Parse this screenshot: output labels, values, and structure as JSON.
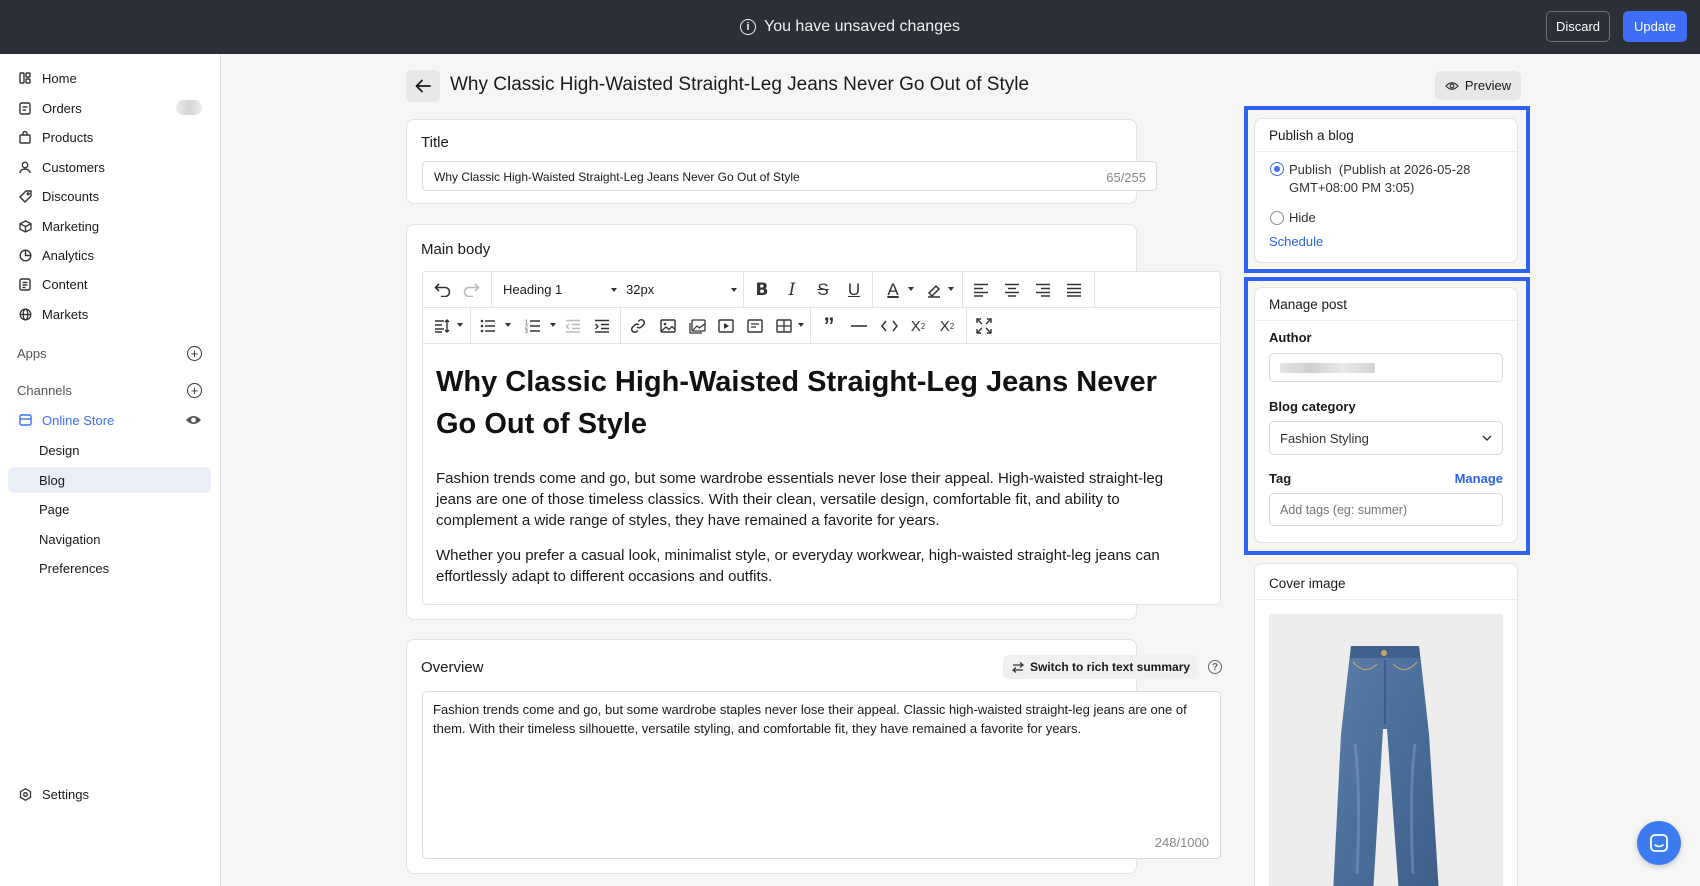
{
  "topbar": {
    "notice": "You have unsaved changes",
    "discard_label": "Discard",
    "update_label": "Update"
  },
  "sidebar": {
    "items": [
      {
        "label": "Home",
        "icon": "home-icon"
      },
      {
        "label": "Orders",
        "icon": "orders-icon"
      },
      {
        "label": "Products",
        "icon": "bag-icon"
      },
      {
        "label": "Customers",
        "icon": "person-icon"
      },
      {
        "label": "Discounts",
        "icon": "tag-icon"
      },
      {
        "label": "Marketing",
        "icon": "cube-icon"
      },
      {
        "label": "Analytics",
        "icon": "pie-icon"
      },
      {
        "label": "Content",
        "icon": "document-icon"
      },
      {
        "label": "Markets",
        "icon": "globe-icon"
      }
    ],
    "apps_label": "Apps",
    "channels_label": "Channels",
    "online_store_label": "Online Store",
    "store_subitems": [
      "Design",
      "Blog",
      "Page",
      "Navigation",
      "Preferences"
    ],
    "active_subitem": "Blog",
    "settings_label": "Settings"
  },
  "header": {
    "title": "Why Classic High-Waisted Straight-Leg Jeans Never Go Out of Style",
    "preview_label": "Preview"
  },
  "title_card": {
    "label": "Title",
    "value": "Why Classic High-Waisted Straight-Leg Jeans Never Go Out of Style",
    "counter": "65/255"
  },
  "main_body": {
    "label": "Main body",
    "heading_select": "Heading 1",
    "size_select": "32px",
    "heading": "Why Classic High-Waisted Straight-Leg Jeans Never Go Out of Style",
    "paragraphs": [
      "Fashion trends come and go, but some wardrobe essentials never lose their appeal. High-waisted straight-leg jeans are one of those timeless classics. With their clean, versatile design, comfortable fit, and ability to complement a wide range of styles, they have remained a favorite for years.",
      "Whether you prefer a casual look, minimalist style, or everyday workwear, high-waisted straight-leg jeans can effortlessly adapt to different occasions and outfits."
    ]
  },
  "overview": {
    "label": "Overview",
    "switch_label": "Switch to rich text summary",
    "text": "Fashion trends come and go, but some wardrobe staples never lose their appeal. Classic high-waisted straight-leg jeans are one of them. With their timeless silhouette, versatile styling, and comfortable fit, they have remained a favorite for years.",
    "counter": "248/1000"
  },
  "publish": {
    "label": "Publish a blog",
    "publish_option": "Publish",
    "publish_detail": "(Publish at 2026-05-28 GMT+08:00 PM 3:05)",
    "hide_option": "Hide",
    "schedule_link": "Schedule",
    "selected": "Publish"
  },
  "manage": {
    "label": "Manage post",
    "author_label": "Author",
    "category_label": "Blog category",
    "category_value": "Fashion Styling",
    "tag_label": "Tag",
    "tag_manage_link": "Manage",
    "tag_placeholder": "Add tags (eg: summer)"
  },
  "cover": {
    "label": "Cover image"
  },
  "colors": {
    "accent": "#3d6ef5",
    "highlight": "#2e63f0",
    "topbar": "#2b2f37"
  }
}
